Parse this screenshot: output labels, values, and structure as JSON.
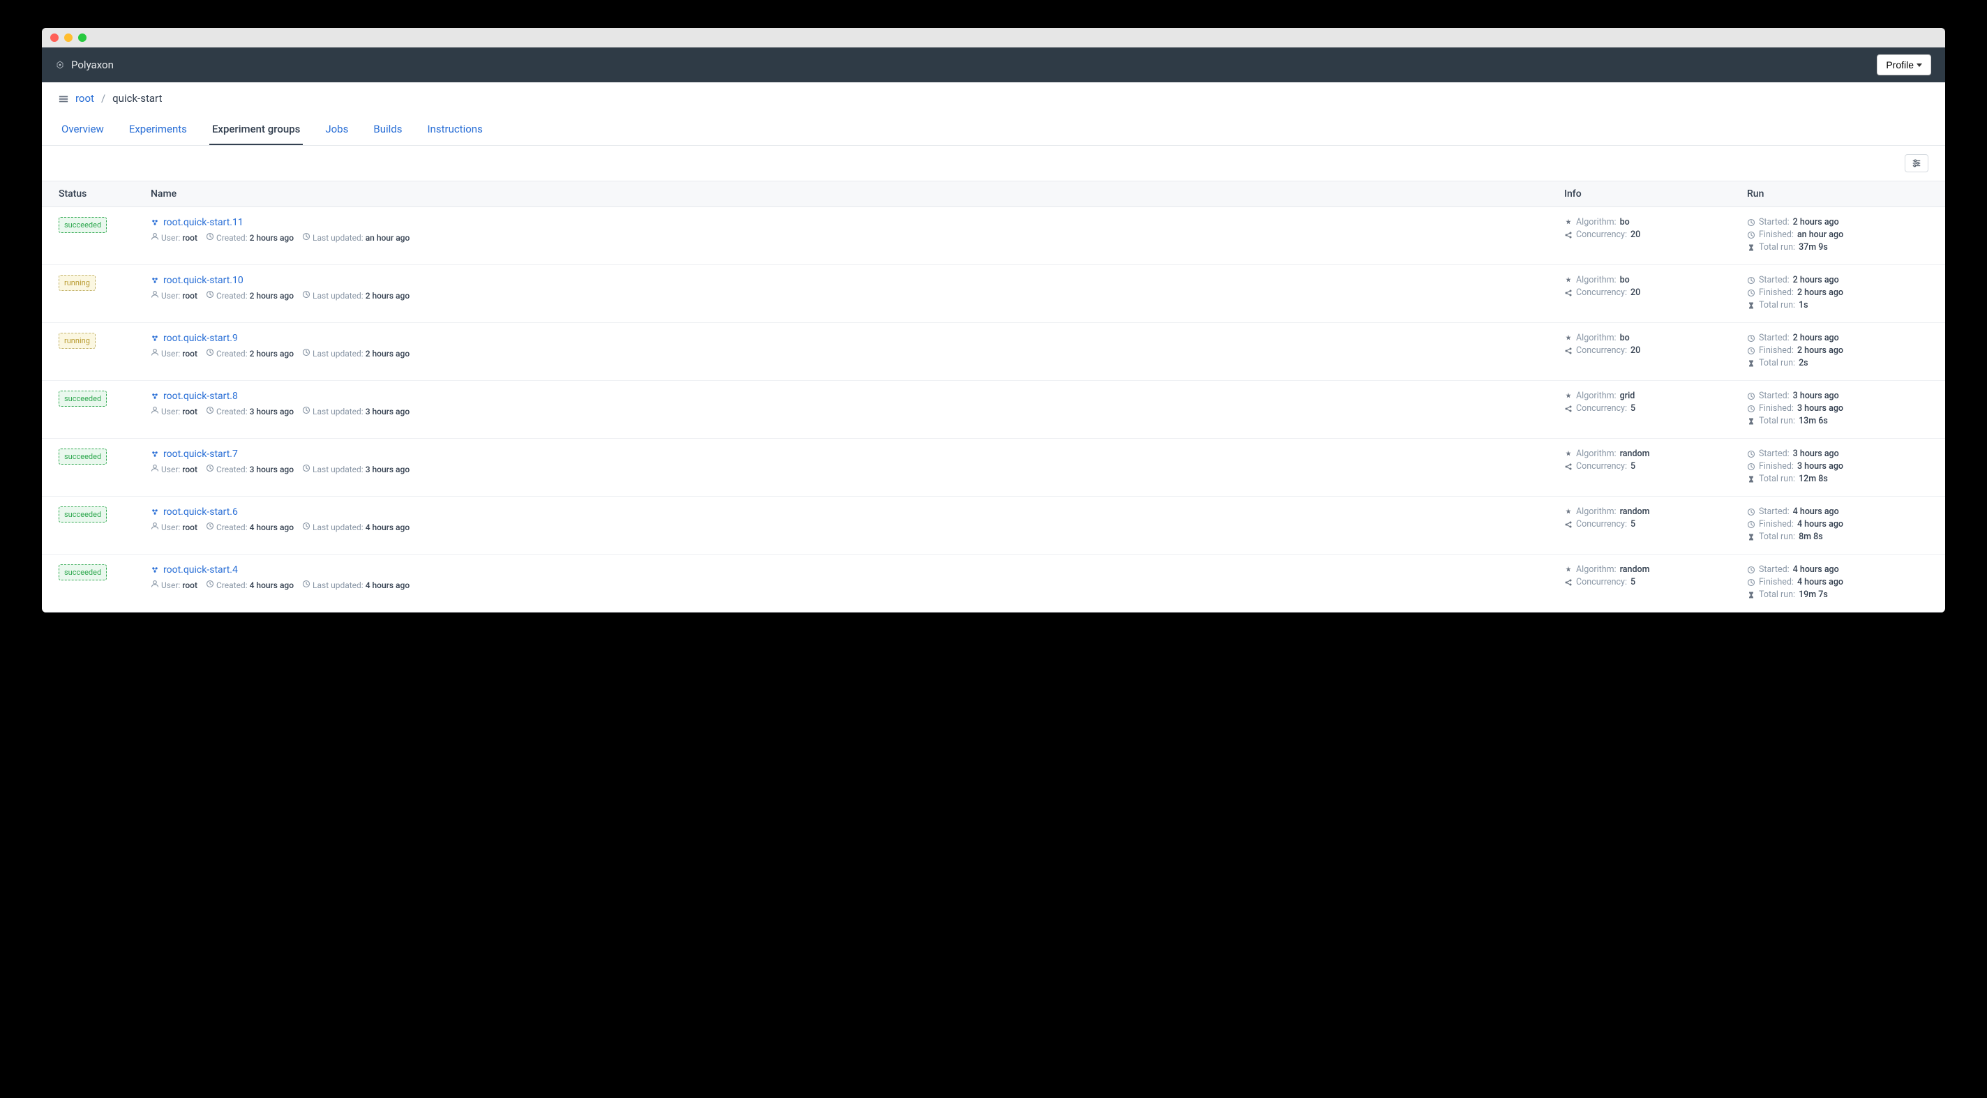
{
  "brand": "Polyaxon",
  "profile_label": "Profile",
  "breadcrumb": {
    "root_label": "root",
    "project": "quick-start"
  },
  "tabs": [
    {
      "label": "Overview",
      "active": false
    },
    {
      "label": "Experiments",
      "active": false
    },
    {
      "label": "Experiment groups",
      "active": true
    },
    {
      "label": "Jobs",
      "active": false
    },
    {
      "label": "Builds",
      "active": false
    },
    {
      "label": "Instructions",
      "active": false
    }
  ],
  "columns": {
    "status": "Status",
    "name": "Name",
    "info": "Info",
    "run": "Run"
  },
  "labels": {
    "user": "User:",
    "created": "Created:",
    "last_updated": "Last updated:",
    "algorithm": "Algorithm:",
    "concurrency": "Concurrency:",
    "started": "Started:",
    "finished": "Finished:",
    "total_run": "Total run:"
  },
  "groups": [
    {
      "status": "succeeded",
      "name": "root.quick-start.11",
      "user": "root",
      "created": "2 hours ago",
      "last_updated": "an hour ago",
      "algorithm": "bo",
      "concurrency": "20",
      "started": "2 hours ago",
      "finished": "an hour ago",
      "total_run": "37m 9s"
    },
    {
      "status": "running",
      "name": "root.quick-start.10",
      "user": "root",
      "created": "2 hours ago",
      "last_updated": "2 hours ago",
      "algorithm": "bo",
      "concurrency": "20",
      "started": "2 hours ago",
      "finished": "2 hours ago",
      "total_run": "1s"
    },
    {
      "status": "running",
      "name": "root.quick-start.9",
      "user": "root",
      "created": "2 hours ago",
      "last_updated": "2 hours ago",
      "algorithm": "bo",
      "concurrency": "20",
      "started": "2 hours ago",
      "finished": "2 hours ago",
      "total_run": "2s"
    },
    {
      "status": "succeeded",
      "name": "root.quick-start.8",
      "user": "root",
      "created": "3 hours ago",
      "last_updated": "3 hours ago",
      "algorithm": "grid",
      "concurrency": "5",
      "started": "3 hours ago",
      "finished": "3 hours ago",
      "total_run": "13m 6s"
    },
    {
      "status": "succeeded",
      "name": "root.quick-start.7",
      "user": "root",
      "created": "3 hours ago",
      "last_updated": "3 hours ago",
      "algorithm": "random",
      "concurrency": "5",
      "started": "3 hours ago",
      "finished": "3 hours ago",
      "total_run": "12m 8s"
    },
    {
      "status": "succeeded",
      "name": "root.quick-start.6",
      "user": "root",
      "created": "4 hours ago",
      "last_updated": "4 hours ago",
      "algorithm": "random",
      "concurrency": "5",
      "started": "4 hours ago",
      "finished": "4 hours ago",
      "total_run": "8m 8s"
    },
    {
      "status": "succeeded",
      "name": "root.quick-start.4",
      "user": "root",
      "created": "4 hours ago",
      "last_updated": "4 hours ago",
      "algorithm": "random",
      "concurrency": "5",
      "started": "4 hours ago",
      "finished": "4 hours ago",
      "total_run": "19m 7s"
    }
  ]
}
